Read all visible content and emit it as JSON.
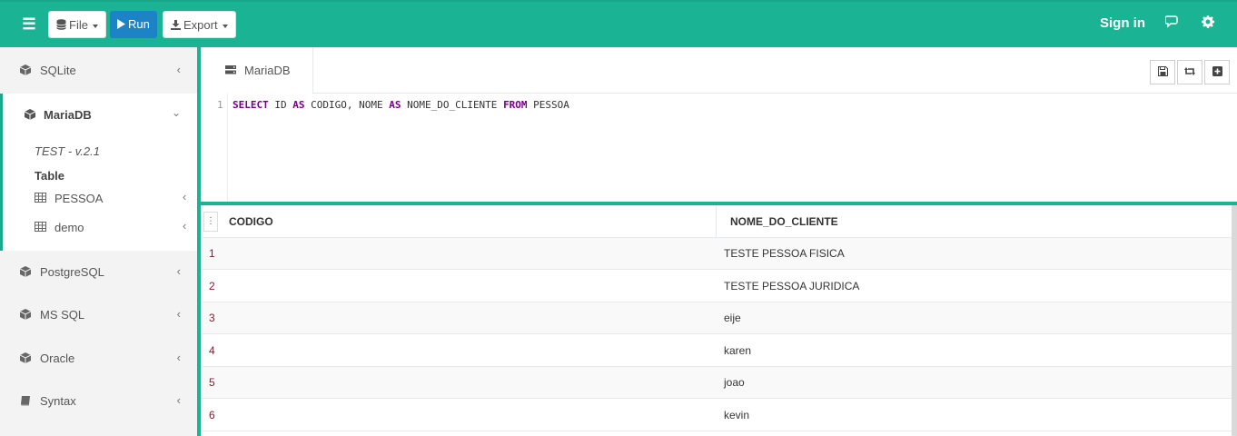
{
  "toolbar": {
    "file_label": "File",
    "run_label": "Run",
    "export_label": "Export",
    "sign_in_label": "Sign in",
    "menu_icon": "hamburger-icon",
    "chat_icon": "chat-icon",
    "settings_icon": "gear-icon"
  },
  "sidebar": {
    "items": [
      {
        "label": "SQLite"
      },
      {
        "label": "MariaDB"
      },
      {
        "label": "PostgreSQL"
      },
      {
        "label": "MS SQL"
      },
      {
        "label": "Oracle"
      },
      {
        "label": "Syntax"
      }
    ],
    "mariadb": {
      "version": "TEST - v.2.1",
      "table_heading": "Table",
      "tables": [
        {
          "label": "PESSOA"
        },
        {
          "label": "demo"
        }
      ]
    }
  },
  "tab": {
    "label": "MariaDB"
  },
  "editor": {
    "line_number": "1",
    "query": {
      "select": "SELECT",
      "part1": " ID ",
      "as1": "AS",
      "part2": " CODIGO, NOME ",
      "as2": "AS",
      "part3": " NOME_DO_CLIENTE ",
      "from": "FROM",
      "part4": " PESSOA"
    }
  },
  "results": {
    "columns": [
      "CODIGO",
      "NOME_DO_CLIENTE"
    ],
    "rows": [
      {
        "codigo": "1",
        "nome": "TESTE PESSOA FISICA"
      },
      {
        "codigo": "2",
        "nome": "TESTE PESSOA JURIDICA"
      },
      {
        "codigo": "3",
        "nome": "eije"
      },
      {
        "codigo": "4",
        "nome": "karen"
      },
      {
        "codigo": "5",
        "nome": "joao"
      },
      {
        "codigo": "6",
        "nome": "kevin"
      }
    ]
  },
  "colors": {
    "brand": "#1ab394",
    "run": "#1c84c6",
    "keyword": "#770088",
    "id_text": "#8b1a2b"
  }
}
